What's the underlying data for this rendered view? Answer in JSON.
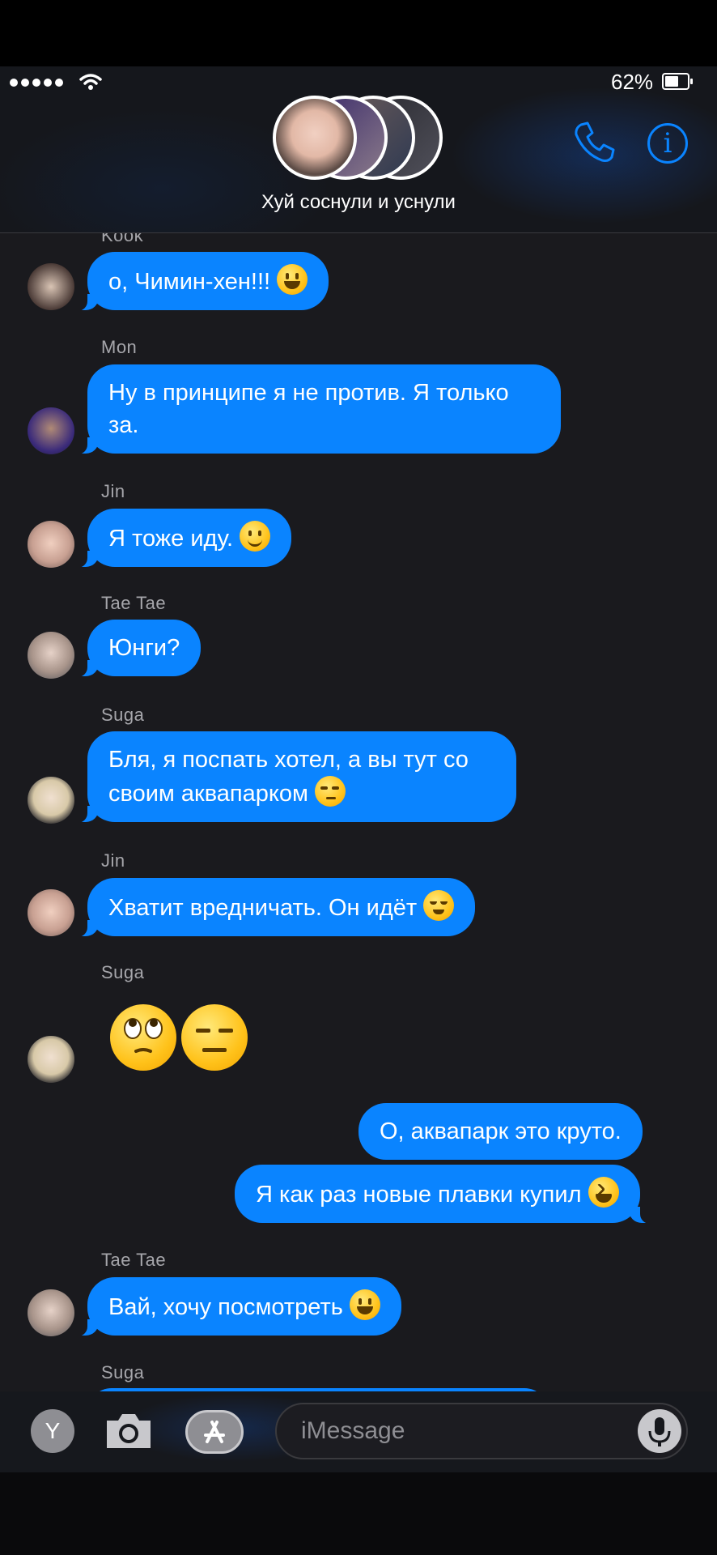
{
  "status_bar": {
    "battery_percent_label": "62%",
    "battery_level": 0.62
  },
  "header": {
    "group_name": "Хуй соснули и уснули",
    "accent_color": "#0a84ff"
  },
  "messages": [
    {
      "sender": "Kook",
      "text": "о, Чимин-хен!!!",
      "emoji": "grinning-face",
      "direction": "incoming"
    },
    {
      "sender": "Mon",
      "lines": [
        "Ну в принципе я не против. Я только",
        "за."
      ],
      "direction": "incoming"
    },
    {
      "sender": "Jin",
      "text": "Я тоже иду.",
      "emoji": "slightly-smiling-face",
      "direction": "incoming"
    },
    {
      "sender": "Tae Tae",
      "text": "Юнги?",
      "direction": "incoming"
    },
    {
      "sender": "Suga",
      "lines": [
        "Бля, я поспать хотел, а вы тут со",
        "своим аквапарком"
      ],
      "emoji": "unamused-face",
      "direction": "incoming"
    },
    {
      "sender": "Jin",
      "text": "Хватит вредничать. Он идёт",
      "emoji": "relieved-face",
      "direction": "incoming"
    },
    {
      "sender": "Suga",
      "emojis": [
        "face-with-rolling-eyes",
        "expressionless-face"
      ],
      "direction": "incoming"
    },
    {
      "text": "О, аквапарк это круто.",
      "direction": "outgoing"
    },
    {
      "text": "Я как раз новые плавки купил",
      "emoji": "grinning-squinting-face",
      "direction": "outgoing"
    },
    {
      "sender": "Tae Tae",
      "text": "Вай, хочу посмотреть",
      "emoji": "grinning-face",
      "direction": "incoming"
    },
    {
      "sender": "Suga",
      "direction": "incoming"
    }
  ],
  "input_bar": {
    "y_button_label": "Y",
    "placeholder": "iMessage"
  }
}
